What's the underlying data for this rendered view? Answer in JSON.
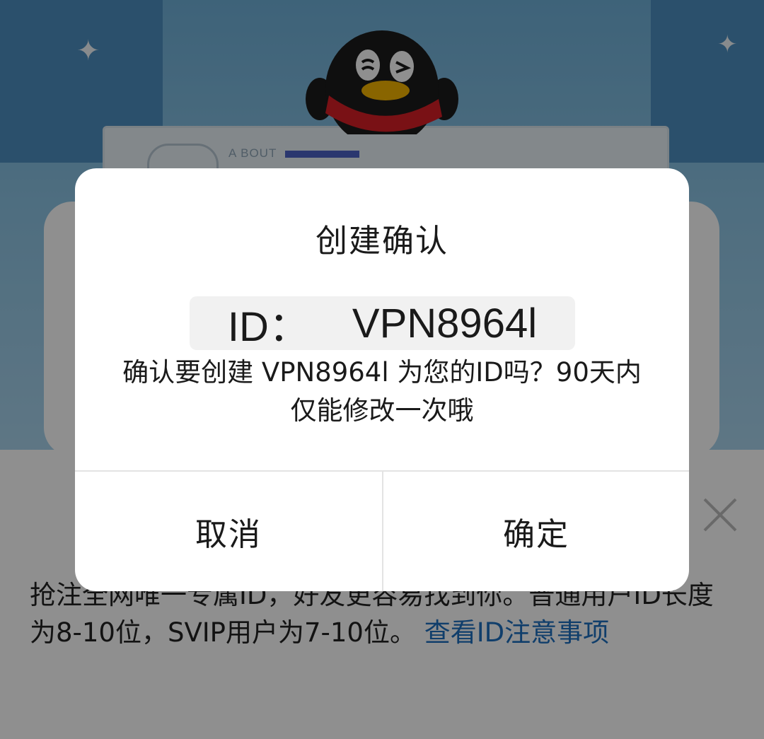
{
  "background": {
    "banner_text": "A BOUT",
    "info_text": "抢注全网唯一专属ID，好友更容易找到你。普通用户ID长度为8-10位，SVIP用户为7-10位。",
    "info_link": "查看ID注意事项"
  },
  "dialog": {
    "title": "创建确认",
    "id_label": "ID：",
    "id_value": "VPN8964l",
    "message": "确认要创建 VPN8964l 为您的ID吗？90天内仅能修改一次哦",
    "cancel_label": "取消",
    "confirm_label": "确定"
  },
  "colors": {
    "link": "#1d6fbf",
    "overlay": "rgba(0,0,0,0.44)"
  },
  "icons": {
    "close": "close-icon",
    "mascot": "penguin-mascot"
  }
}
